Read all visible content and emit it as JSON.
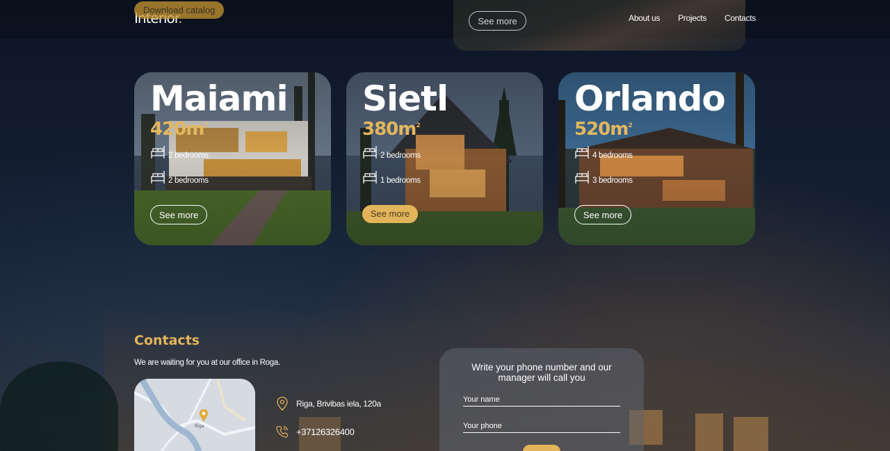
{
  "header": {
    "logo": "Interior",
    "logo_dot": ".",
    "download_label": "Download catalog",
    "see_more_label": "See more",
    "nav": [
      "About us",
      "Projects",
      "Contacts"
    ]
  },
  "cards": [
    {
      "title": "Maiami",
      "area": "420m",
      "area_sup": "2",
      "features": [
        "2 bedrooms",
        "2 bedrooms"
      ],
      "button": "See more"
    },
    {
      "title": "Sietl",
      "area": "380m",
      "area_sup": "2",
      "features": [
        "2 bedrooms",
        "1 bedrooms"
      ],
      "button": "See more"
    },
    {
      "title": "Orlando",
      "area": "520m",
      "area_sup": "2",
      "features": [
        "4 bedrooms",
        "3 bedrooms"
      ],
      "button": "See more"
    }
  ],
  "contacts": {
    "title": "Contacts",
    "subtitle": "We are waiting for you at our office in Roga.",
    "address": "Riga, Brivibas iela, 120a",
    "phone": "+37126326400",
    "map_label": "Rīga"
  },
  "form": {
    "title": "Write your phone number and our manager will call you",
    "name_placeholder": "Your name",
    "phone_placeholder": "Your phone"
  },
  "colors": {
    "accent": "#e3b55b",
    "background": "#131d30"
  },
  "icons": {
    "bed": "bed-icon",
    "location": "location-pin-icon",
    "phone": "phone-icon"
  }
}
